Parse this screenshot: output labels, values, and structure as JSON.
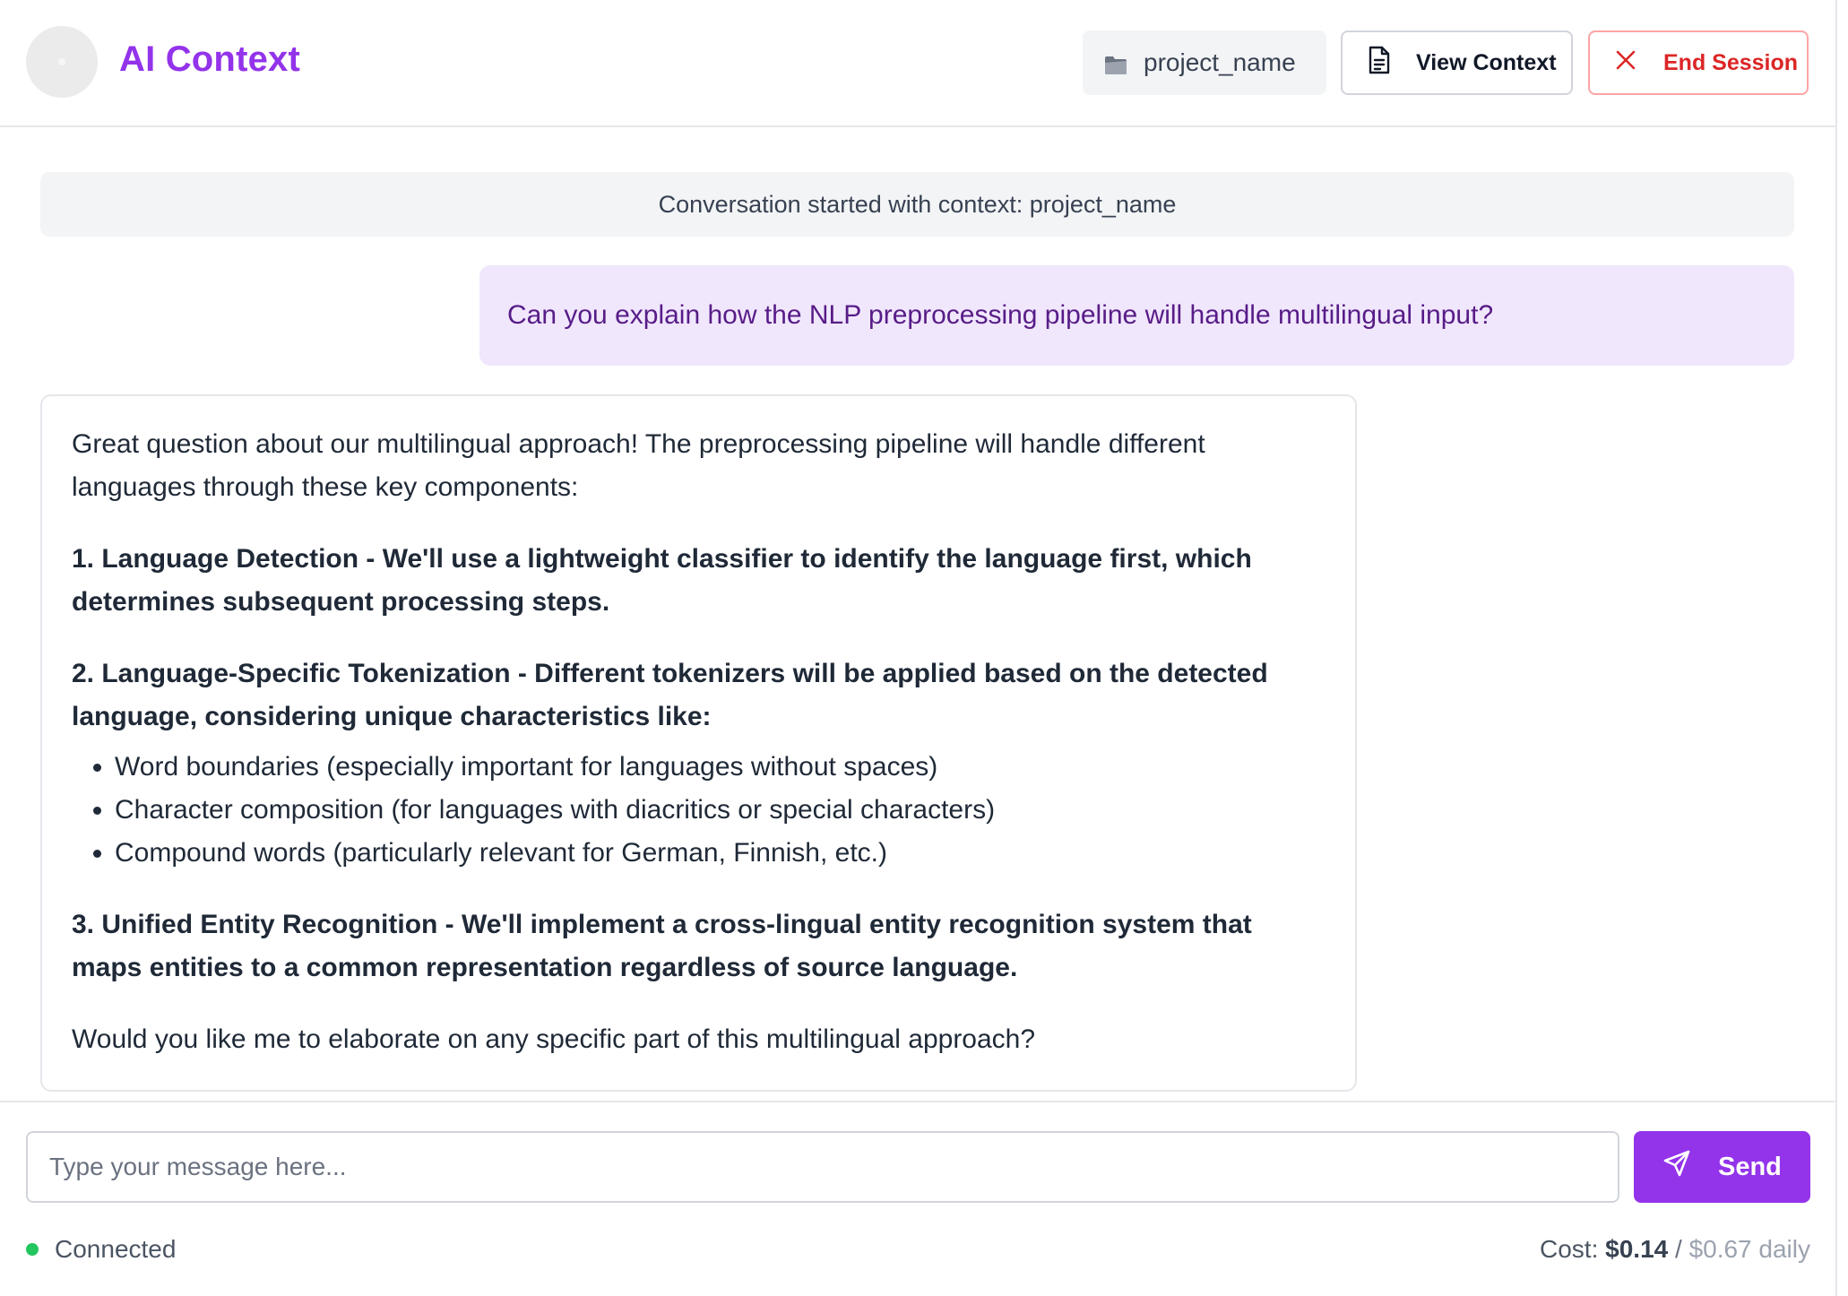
{
  "header": {
    "title": "AI Context",
    "project_chip": "project_name",
    "view_context_label": "View Context",
    "end_session_label": "End Session"
  },
  "chat": {
    "system_message": "Conversation started with context: project_name",
    "user_message": "Can you explain how the NLP preprocessing pipeline will handle multilingual input?",
    "assistant": {
      "intro": "Great question about our multilingual approach! The preprocessing pipeline will handle different languages through these key components:",
      "point1": "1. Language Detection - We'll use a lightweight classifier to identify the language first, which determines subsequent processing steps.",
      "point2": "2. Language-Specific Tokenization - Different tokenizers will be applied based on the detected language, considering unique characteristics like:",
      "bullets": [
        "Word boundaries (especially important for languages without spaces)",
        "Character composition (for languages with diacritics or special characters)",
        "Compound words (particularly relevant for German, Finnish, etc.)"
      ],
      "point3": "3. Unified Entity Recognition - We'll implement a cross-lingual entity recognition system that maps entities to a common representation regardless of source language.",
      "outro": "Would you like me to elaborate on any specific part of this multilingual approach?"
    }
  },
  "composer": {
    "value": "",
    "placeholder": "Type your message here...",
    "send_label": "Send"
  },
  "status": {
    "label": "Connected",
    "color": "#22c55e"
  },
  "cost": {
    "prefix": "Cost:",
    "session": "$0.14",
    "separator": "/",
    "daily": "$0.67 daily"
  },
  "icons": {
    "avatar": "avatar",
    "project": "folder-icon",
    "view_context": "document-icon",
    "end_session": "close-icon",
    "send": "send-icon",
    "status": "status-dot"
  },
  "colors": {
    "accent": "#9333ea",
    "danger": "#dc2626",
    "user_bubble": "#f0e7fd",
    "user_text": "#581c87"
  }
}
